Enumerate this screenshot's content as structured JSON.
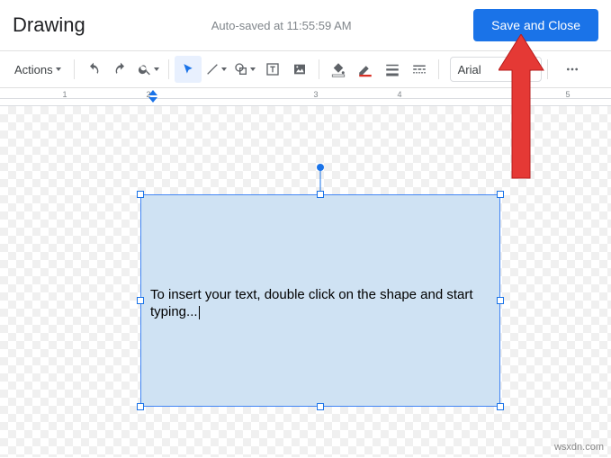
{
  "header": {
    "title": "Drawing",
    "autosave": "Auto-saved at 11:55:59 AM",
    "save_close": "Save and Close"
  },
  "toolbar": {
    "actions": "Actions",
    "font": "Arial"
  },
  "ruler": {
    "marks": [
      "1",
      "2",
      "3",
      "4",
      "5"
    ]
  },
  "canvas": {
    "shape_text": "To insert your text, double click on the shape and start typing..."
  },
  "watermark": "wsxdn.com"
}
